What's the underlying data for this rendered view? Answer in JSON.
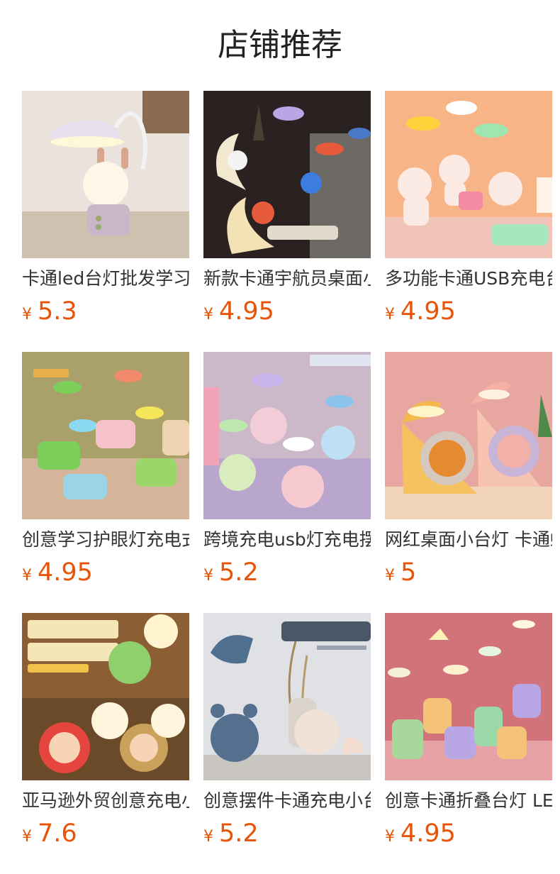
{
  "section_title": "店铺推荐",
  "products": [
    {
      "name": "卡通led台灯批发学习护眼灯",
      "currency": "¥",
      "price": "5.3",
      "icon": "rabbit-lamp-image",
      "bg": "#e9e3db",
      "accent": "#f4f0ee"
    },
    {
      "name": "新款卡通宇航员桌面小台灯",
      "currency": "¥",
      "price": "4.95",
      "icon": "astronaut-lamp-image",
      "bg": "#2a2220",
      "accent": "#e85a3c"
    },
    {
      "name": "多功能卡通USB充电台灯",
      "currency": "¥",
      "price": "4.95",
      "icon": "bear-lamp-image",
      "bg": "#f7b487",
      "accent": "#ffd23c"
    },
    {
      "name": "创意学习护眼灯充电式",
      "currency": "¥",
      "price": "4.95",
      "icon": "train-lamp-image",
      "bg": "#a9a06a",
      "accent": "#7ccf5a"
    },
    {
      "name": "跨境充电usb灯充电摆件",
      "currency": "¥",
      "price": "5.2",
      "icon": "spaceman-lamp-image",
      "bg": "#cbb9c9",
      "accent": "#b9a6e4"
    },
    {
      "name": "网红桌面小台灯 卡通蜗牛",
      "currency": "¥",
      "price": "5",
      "icon": "snail-lamp-image",
      "bg": "#e7a7a0",
      "accent": "#f5b84a"
    },
    {
      "name": "亚马逊外贸创意充电小夜灯",
      "currency": "¥",
      "price": "7.6",
      "icon": "animal-nightlight-image",
      "bg": "#6b4a2a",
      "accent": "#e5453c"
    },
    {
      "name": "创意摆件卡通充电小台灯",
      "currency": "¥",
      "price": "5.2",
      "icon": "bear-deer-lamp-image",
      "bg": "#dfe1e4",
      "accent": "#4f6f8f"
    },
    {
      "name": "创意卡通折叠台灯 LED",
      "currency": "¥",
      "price": "4.95",
      "icon": "folding-lamp-image",
      "bg": "#d2737a",
      "accent": "#9bd9a8"
    }
  ]
}
